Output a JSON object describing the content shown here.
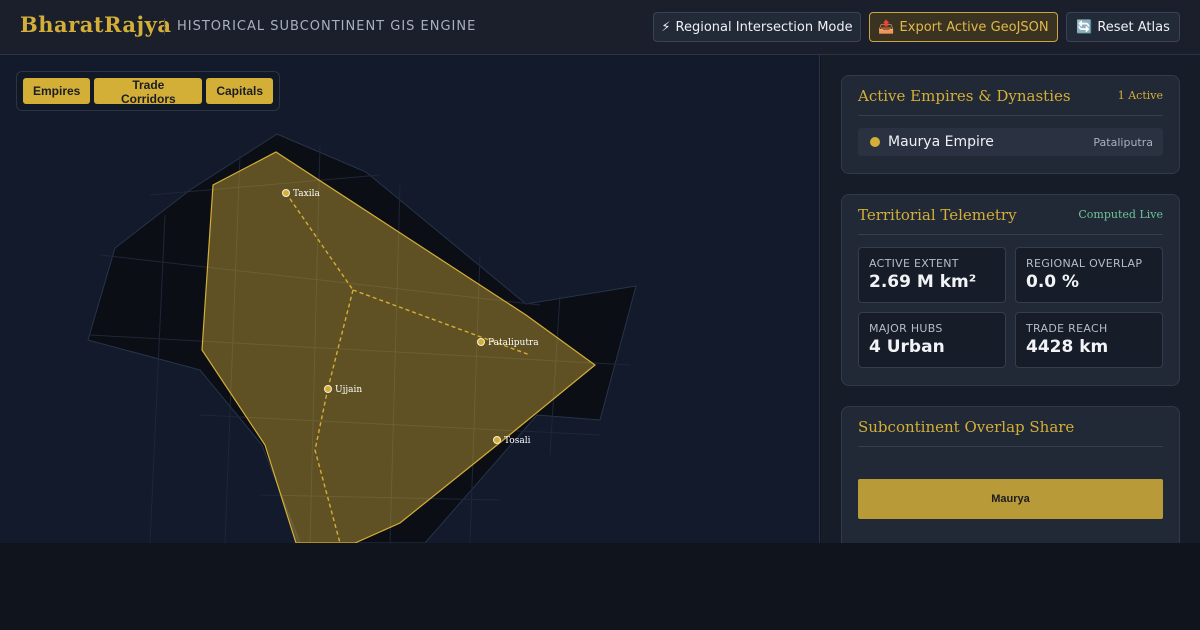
{
  "brand": "BharatRajya",
  "tagline": "HISTORICAL SUBCONTINENT GIS ENGINE",
  "header_buttons": [
    {
      "icon": "⚡",
      "label": "Regional Intersection Mode"
    },
    {
      "icon": "📤",
      "label": "Export Active GeoJSON"
    },
    {
      "icon": "🔄",
      "label": "Reset Atlas"
    }
  ],
  "layers": [
    "Empires",
    "Trade Corridors",
    "Capitals"
  ],
  "map": {
    "cities": [
      "Taxila",
      "Pataliputra",
      "Ujjain",
      "Tosali"
    ],
    "colors": {
      "territory": "#d4af37",
      "land": "#0b0e15",
      "ocean": "#121a2b"
    }
  },
  "empires_card": {
    "title": "Active Empires & Dynasties",
    "count": "1 Active",
    "items": [
      {
        "name": "Maurya Empire",
        "capital": "Pataliputra",
        "color": "#d4af37"
      }
    ]
  },
  "telemetry_card": {
    "title": "Territorial Telemetry",
    "status": "Computed Live",
    "stats": [
      {
        "label": "ACTIVE EXTENT",
        "value": "2.69 M km²"
      },
      {
        "label": "REGIONAL OVERLAP",
        "value": "0.0 %"
      },
      {
        "label": "MAJOR HUBS",
        "value": "4 Urban"
      },
      {
        "label": "TRADE REACH",
        "value": "4428 km"
      }
    ]
  },
  "share_card": {
    "title": "Subcontinent Overlap Share",
    "bar_label": "Maurya",
    "share": 1.0
  }
}
